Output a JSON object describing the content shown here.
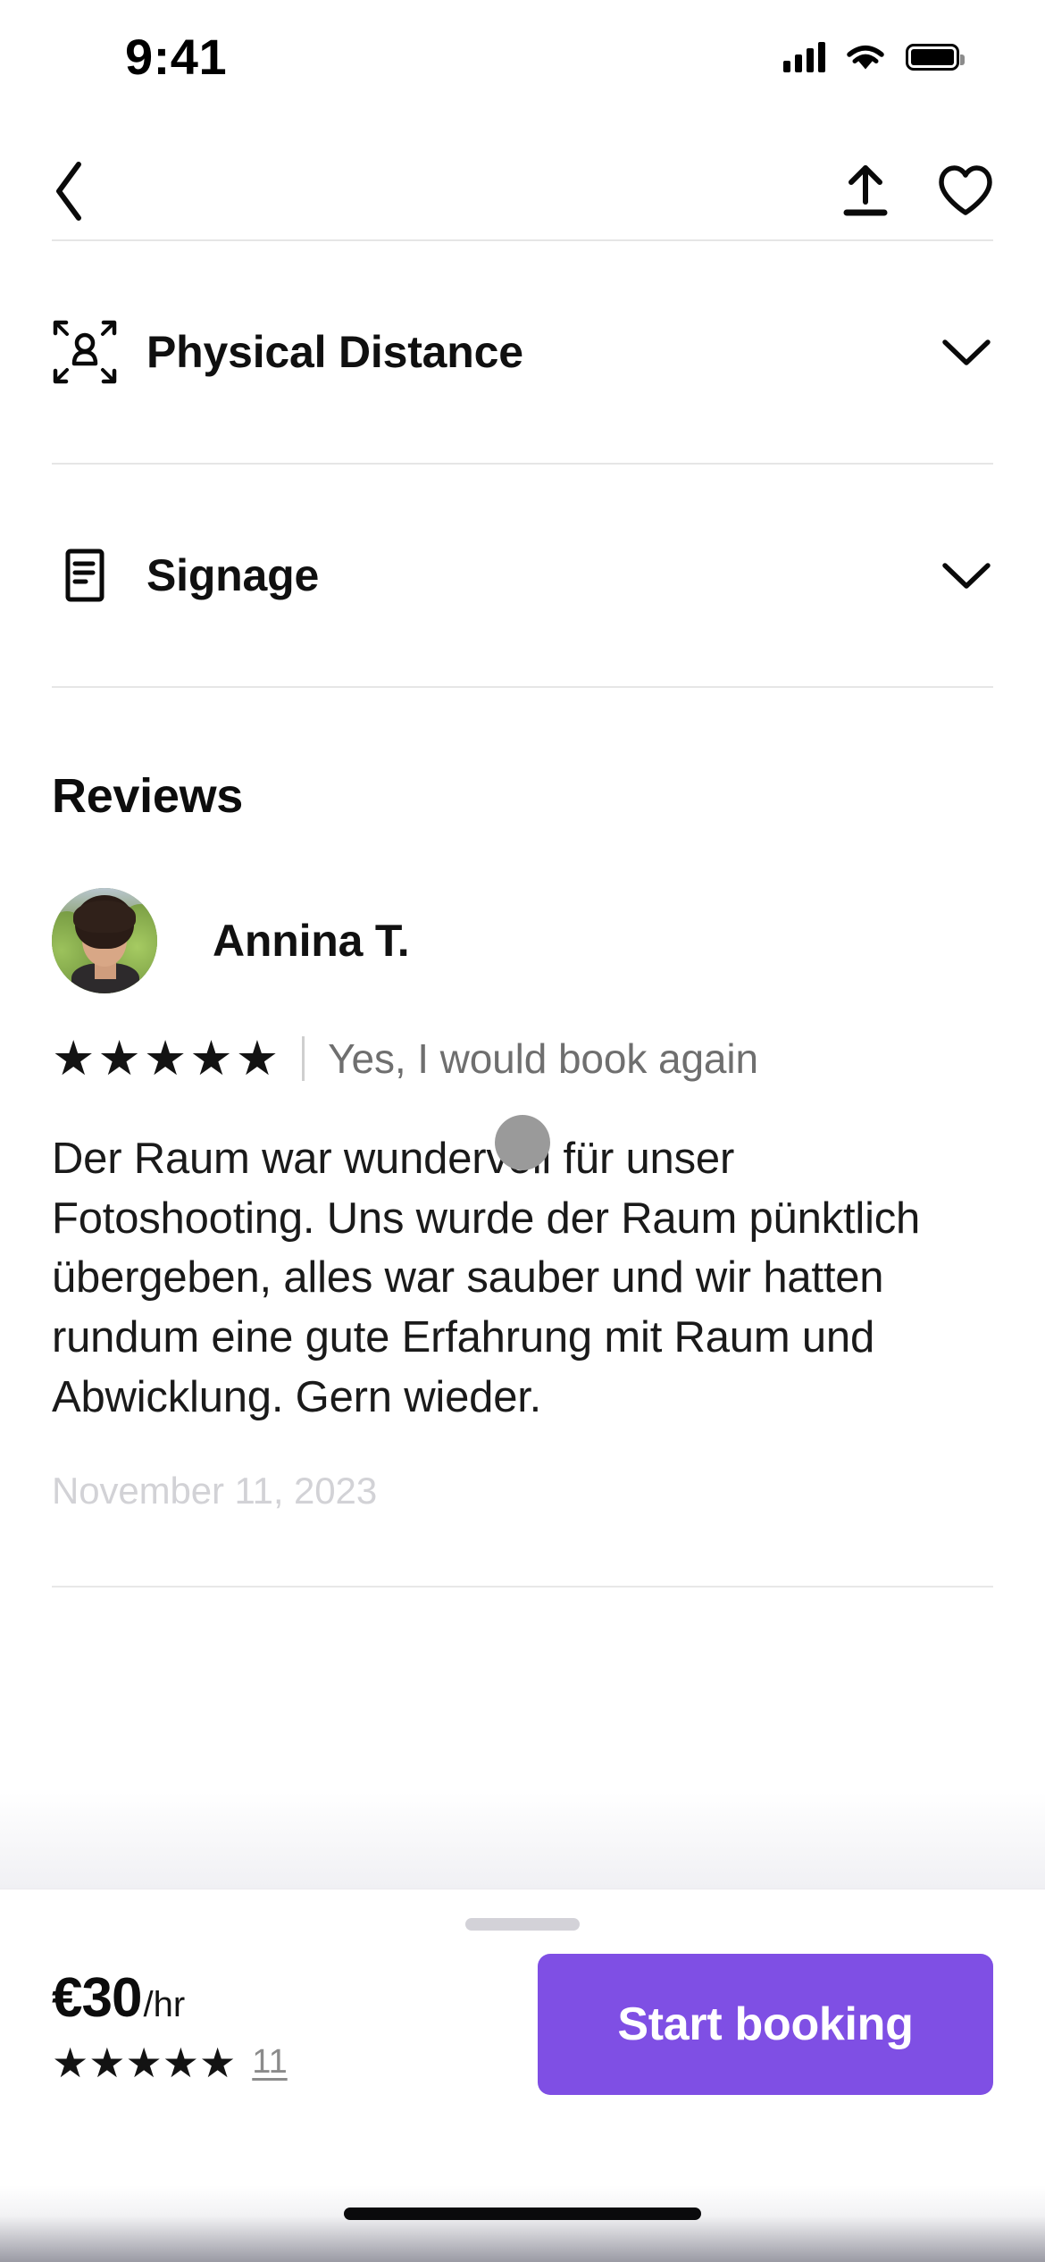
{
  "status_bar": {
    "time": "9:41",
    "cellular_icon": "cellular-signal-icon",
    "wifi_icon": "wifi-icon",
    "battery_icon": "battery-full-icon"
  },
  "nav_bar": {
    "back_icon": "chevron-left-icon",
    "share_icon": "share-upload-icon",
    "favorite_icon": "heart-outline-icon"
  },
  "accordions": [
    {
      "label": "Physical Distance",
      "icon": "physical-distance-icon",
      "chevron": "chevron-down-icon",
      "expanded": "false"
    },
    {
      "label": "Signage",
      "icon": "signage-document-icon",
      "chevron": "chevron-down-icon",
      "expanded": "false"
    }
  ],
  "reviews": {
    "section_title": "Reviews",
    "items": [
      {
        "author": "Annina T.",
        "avatar": "reviewer-avatar-photo",
        "stars": 5,
        "recommendation": "Yes, I would book again",
        "text": "Der Raum war wundervoll für unser Fotoshooting. Uns wurde der Raum pünktlich übergeben, alles war sauber und wir hatten rundum eine gute Erfahrung mit Raum und Abwicklung. Gern wieder.",
        "date": "November 11, 2023"
      }
    ]
  },
  "booking_bar": {
    "grabber": "sheet-drag-handle",
    "price_amount": "€30",
    "price_unit": "/hr",
    "stars": 5,
    "review_count": "11",
    "cta_label": "Start booking",
    "cta_color": "#7f4fe4"
  },
  "overlay": {
    "touch_indicator": "touch-point-indicator"
  },
  "home_indicator": "home-indicator-bar"
}
